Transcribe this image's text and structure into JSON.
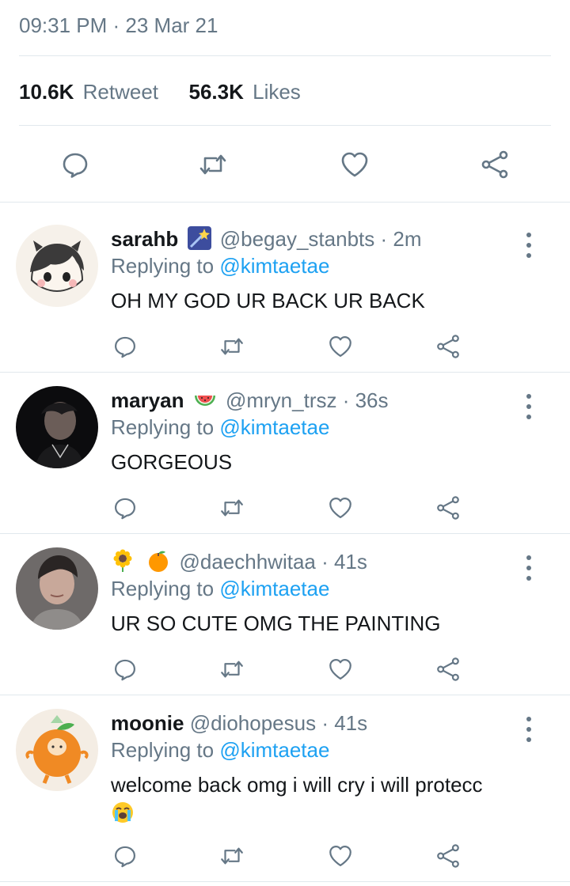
{
  "tweet": {
    "timestamp": "09:31 PM · 23 Mar 21",
    "retweet_count": "10.6K",
    "retweet_label": "Retweet",
    "likes_count": "56.3K",
    "likes_label": "Likes"
  },
  "replies": [
    {
      "name": "sarahb",
      "name_emoji": "shooting-star-emoji",
      "handle": "@begay_stanbts",
      "time": "· 2m",
      "replying_prefix": "Replying to",
      "replying_to": "@kimtaetae",
      "text": "OH MY GOD UR BACK UR BACK"
    },
    {
      "name": "maryan",
      "name_emoji": "watermelon-emoji",
      "handle": "@mryn_trsz",
      "time": "· 36s",
      "replying_prefix": "Replying to",
      "replying_to": "@kimtaetae",
      "text": "GORGEOUS"
    },
    {
      "name": "",
      "name_emoji": "sunflower-emoji tangerine-emoji",
      "handle": "@daechhwitaa",
      "time": "· 41s",
      "replying_prefix": "Replying to",
      "replying_to": "@kimtaetae",
      "text": "UR SO CUTE OMG THE PAINTING"
    },
    {
      "name": "moonie",
      "handle": "@diohopesus",
      "time": "· 41s",
      "replying_prefix": "Replying to",
      "replying_to": "@kimtaetae",
      "text": "welcome back omg i will cry i will protecc",
      "trailing_emoji": "loudly-crying-face-emoji"
    }
  ],
  "colors": {
    "secondary_text": "#657786",
    "link": "#1da1f2",
    "divider": "#e1e8ed"
  }
}
